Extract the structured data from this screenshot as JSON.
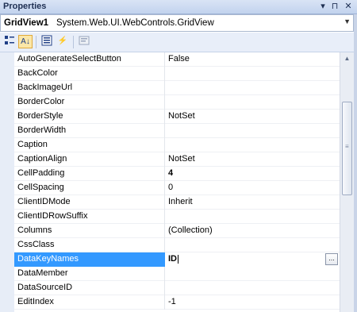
{
  "window": {
    "title": "Properties"
  },
  "object": {
    "name": "GridView1",
    "type": "System.Web.UI.WebControls.GridView"
  },
  "toolbar": {
    "buttons": [
      {
        "name": "categorized-button",
        "icon": "categorized-icon"
      },
      {
        "name": "alphabetical-button",
        "icon": "sort-az-icon",
        "glyph": "A↓"
      },
      {
        "name": "properties-button",
        "icon": "properties-icon"
      },
      {
        "name": "events-button",
        "icon": "lightning-icon",
        "glyph": "⚡"
      },
      {
        "name": "property-pages-button",
        "icon": "property-pages-icon"
      }
    ]
  },
  "properties": [
    {
      "name": "AutoGenerateSelectButton",
      "value": "False"
    },
    {
      "name": "BackColor",
      "value": ""
    },
    {
      "name": "BackImageUrl",
      "value": ""
    },
    {
      "name": "BorderColor",
      "value": ""
    },
    {
      "name": "BorderStyle",
      "value": "NotSet"
    },
    {
      "name": "BorderWidth",
      "value": ""
    },
    {
      "name": "Caption",
      "value": ""
    },
    {
      "name": "CaptionAlign",
      "value": "NotSet"
    },
    {
      "name": "CellPadding",
      "value": "4",
      "bold": true
    },
    {
      "name": "CellSpacing",
      "value": "0"
    },
    {
      "name": "ClientIDMode",
      "value": "Inherit"
    },
    {
      "name": "ClientIDRowSuffix",
      "value": ""
    },
    {
      "name": "Columns",
      "value": "(Collection)"
    },
    {
      "name": "CssClass",
      "value": ""
    },
    {
      "name": "DataKeyNames",
      "value": "ID",
      "selected": true
    },
    {
      "name": "DataMember",
      "value": ""
    },
    {
      "name": "DataSourceID",
      "value": ""
    },
    {
      "name": "EditIndex",
      "value": "-1"
    }
  ],
  "glyphs": {
    "pin": "▾",
    "pin2": "⊓",
    "close": "✕",
    "dropdown": "▼",
    "ellipsis": "...",
    "up": "▲",
    "down": "▼"
  }
}
